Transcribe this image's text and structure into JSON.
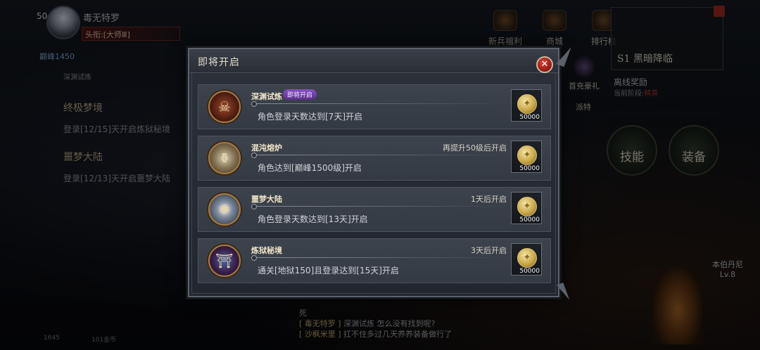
{
  "background": {
    "player": {
      "level": "50",
      "name": "毒无特罗",
      "title": "头衔:[大师Ⅲ]",
      "peak_label": "巅峰1450"
    },
    "side_label": "深渊试炼",
    "quests": [
      {
        "title": "终极梦境",
        "desc": "登录[12/15]天开启炼狱秘境"
      },
      {
        "title": "噩梦大陆",
        "desc": "登录[12/13]天开启噩梦大陆"
      }
    ],
    "top_icons": [
      "新兵福利",
      "商城",
      "排行榜"
    ],
    "mid_icon": "首充豪礼",
    "guard_label": "派特",
    "right_panel": {
      "title": "S1 黑暗降临",
      "sub1": "离线奖励",
      "sub2": "当前阶段:",
      "sub2_value": "精英"
    },
    "skill_buttons": [
      "技能",
      "装备"
    ],
    "pet": {
      "name": "本伯丹尼",
      "level": "Lv.8"
    },
    "chat": [
      {
        "who": "",
        "text": "死"
      },
      {
        "who": "[ 毒无特罗 ]",
        "text": "深渊试炼 怎么没有找到呢?"
      },
      {
        "who": "[ 沙枫米里 ]",
        "text": "扛不住多过几天养养装备做行了"
      }
    ],
    "bottom_stats": [
      "1645",
      "101金币"
    ]
  },
  "dialog": {
    "title": "即将开启",
    "close_icon": "close-x",
    "entries": [
      {
        "name": "深渊试炼",
        "badge": "即将开启",
        "status": "",
        "desc": "角色登录天数达到[7天]开启",
        "icon": "skull-emblem-icon",
        "reward": "50000"
      },
      {
        "name": "混沌熔炉",
        "badge": "",
        "status": "再提升50级后开启",
        "desc": "角色达到[巅峰1500级]开启",
        "icon": "forge-icon",
        "reward": "50000"
      },
      {
        "name": "噩梦大陆",
        "badge": "",
        "status": "1天后开启",
        "desc": "角色登录天数达到[13天]开启",
        "icon": "nightmare-icon",
        "reward": "50000"
      },
      {
        "name": "炼狱秘境",
        "badge": "",
        "status": "3天后开启",
        "desc": "通关[地狱150]且登录达到[15天]开启",
        "icon": "purgatory-icon",
        "reward": "50000"
      }
    ]
  }
}
